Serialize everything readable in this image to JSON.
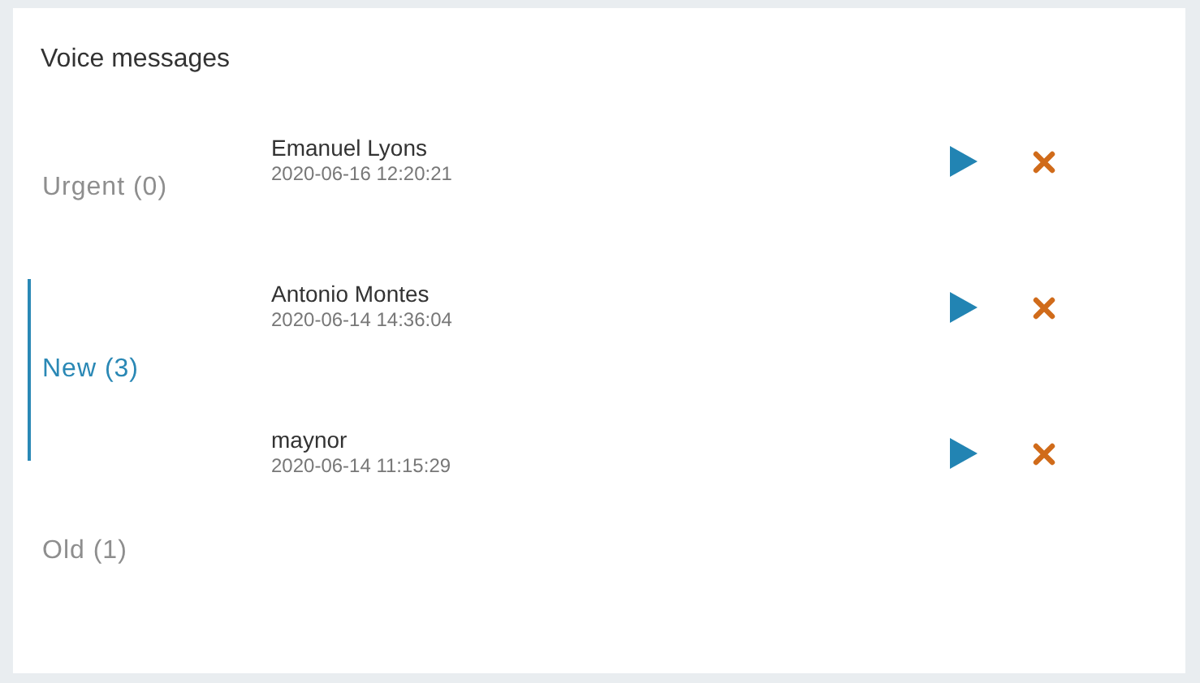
{
  "title": "Voice messages",
  "folders": [
    {
      "label": "Urgent (0)",
      "selected": false
    },
    {
      "label": "New (3)",
      "selected": true
    },
    {
      "label": "Old (1)",
      "selected": false
    }
  ],
  "messages": [
    {
      "caller": "Emanuel Lyons",
      "time": "2020-06-16 12:20:21"
    },
    {
      "caller": "Antonio Montes",
      "time": "2020-06-14 14:36:04"
    },
    {
      "caller": "maynor",
      "time": "2020-06-14 11:15:29"
    }
  ]
}
